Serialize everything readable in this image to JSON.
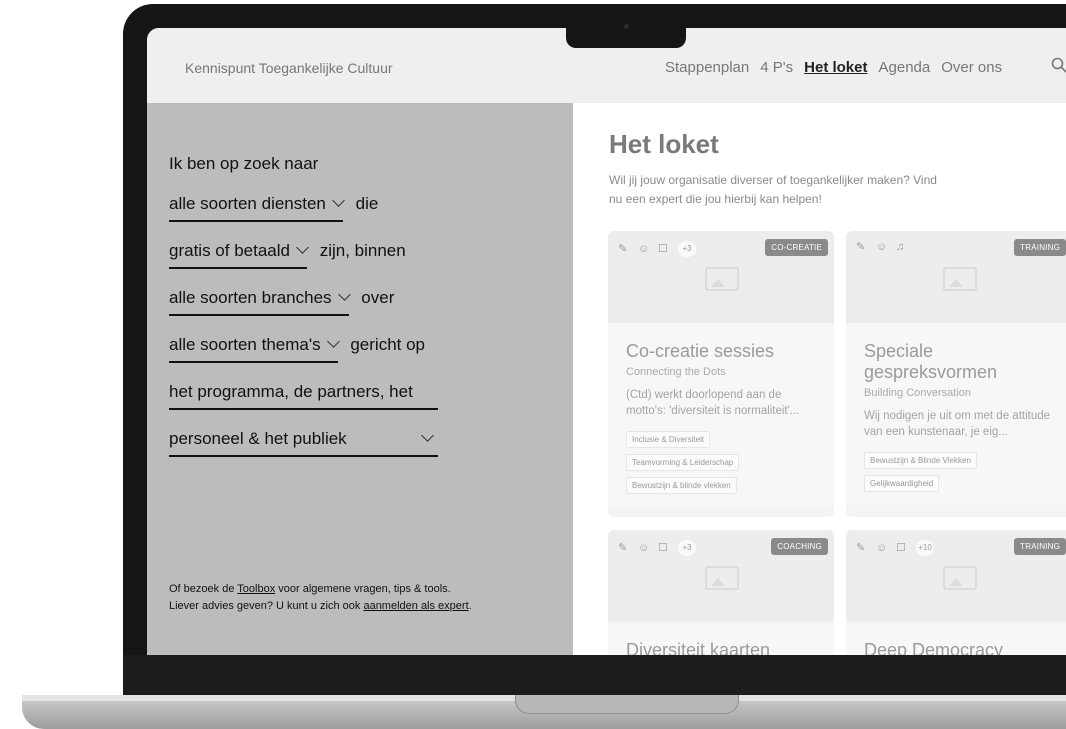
{
  "header": {
    "brand": "Kennispunt Toegankelijke Cultuur",
    "nav": [
      "Stappenplan",
      "4 P's",
      "Het loket",
      "Agenda",
      "Over ons"
    ],
    "active_nav": "Het loket"
  },
  "filters": {
    "intro": "Ik ben op zoek naar",
    "rows": [
      {
        "value": "alle soorten diensten",
        "suffix": "die"
      },
      {
        "value": "gratis of betaald",
        "suffix": "zijn, binnen"
      },
      {
        "value": "alle soorten branches",
        "suffix": "over"
      },
      {
        "value": "alle soorten thema's",
        "suffix": "gericht op"
      },
      {
        "value": "het programma, de partners, het",
        "suffix": ""
      },
      {
        "value": "personeel & het publiek",
        "suffix": ""
      }
    ]
  },
  "footer": {
    "line1_pre": "Of bezoek de ",
    "toolbox_link": "Toolbox",
    "line1_post": " voor algemene vragen, tips & tools.",
    "line2_pre": "Liever advies geven? U kunt u zich ook ",
    "expert_link": "aanmelden als expert",
    "line2_post": "."
  },
  "main": {
    "title": "Het loket",
    "lead": "Wil jij jouw organisatie diverser of toegankelijker maken? Vind nu een expert die jou hierbij kan helpen!"
  },
  "cards": [
    {
      "badge": "CO-CREATIE",
      "more": "+3",
      "icons": [
        "brush-icon",
        "mask-icon",
        "signlanguage-icon"
      ],
      "title": "Co-creatie sessies",
      "subtitle": "Connecting the Dots",
      "desc": "(Ctd) werkt doorlopend aan de motto's: 'diversiteit is normaliteit'...",
      "tags": [
        "Inclusie & Diversiteit",
        "Teamvorming & Leiderschap",
        "Bewustzijn & blinde vlekken"
      ]
    },
    {
      "badge": "TRAINING",
      "more": "",
      "icons": [
        "brush-icon",
        "mask-icon",
        "music-icon"
      ],
      "title": "Speciale gespreksvormen",
      "subtitle": "Building Conversation",
      "desc": "Wij nodigen je uit om met de attitude van een kunstenaar, je eig...",
      "tags": [
        "Bewustzijn & Blinde Vlekken",
        "Gelijkwaardigheid"
      ]
    },
    {
      "badge": "COACHING",
      "more": "+3",
      "icons": [
        "brush-icon",
        "mask-icon",
        "signlanguage-icon"
      ],
      "title": "Diversiteit kaarten",
      "subtitle": "",
      "desc": "",
      "tags": []
    },
    {
      "badge": "TRAINING",
      "more": "+10",
      "icons": [
        "brush-icon",
        "mask-icon",
        "signlanguage-icon"
      ],
      "title": "Deep Democracy",
      "subtitle": "",
      "desc": "",
      "tags": []
    }
  ]
}
